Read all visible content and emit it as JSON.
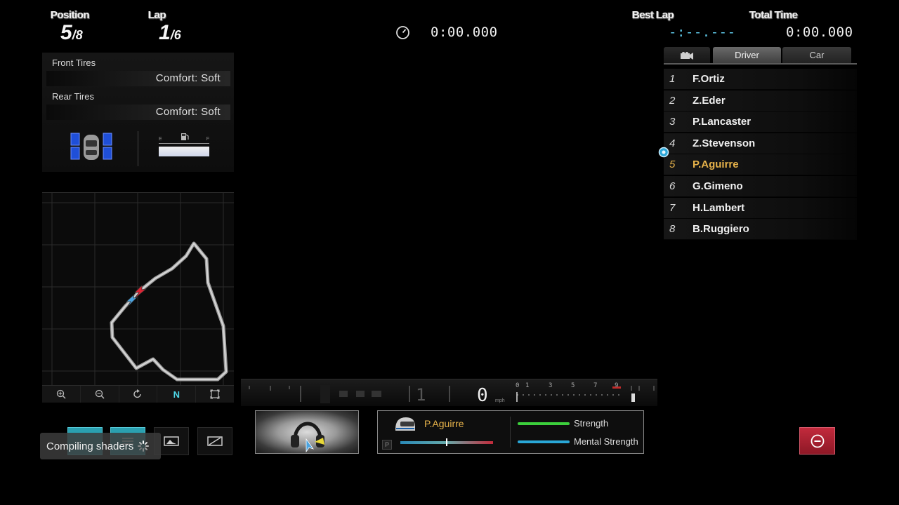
{
  "hud": {
    "position_label": "Position",
    "position_num": "5",
    "position_den": "/8",
    "lap_label": "Lap",
    "lap_num": "1",
    "lap_den": "/6",
    "stopwatch_time": "0:00.000",
    "best_lap_label": "Best Lap",
    "best_lap_value": "-:--.---",
    "total_time_label": "Total Time",
    "total_time_value": "0:00.000"
  },
  "tires": {
    "front_label": "Front Tires",
    "front_value": "Comfort: Soft",
    "rear_label": "Rear Tires",
    "rear_value": "Comfort: Soft",
    "fuel_empty_label": "E",
    "fuel_full_label": "F",
    "fuel_level": 1.0
  },
  "tabs": {
    "camera_icon": "camera-icon",
    "driver_label": "Driver",
    "car_label": "Car",
    "active": "Driver"
  },
  "standings": [
    {
      "pos": "1",
      "name": "F.Ortiz"
    },
    {
      "pos": "2",
      "name": "Z.Eder"
    },
    {
      "pos": "3",
      "name": "P.Lancaster"
    },
    {
      "pos": "4",
      "name": "Z.Stevenson"
    },
    {
      "pos": "5",
      "name": "P.Aguirre",
      "highlight": true
    },
    {
      "pos": "6",
      "name": "G.Gimeno"
    },
    {
      "pos": "7",
      "name": "H.Lambert"
    },
    {
      "pos": "8",
      "name": "B.Ruggiero"
    }
  ],
  "map_toolbar": [
    "zoom-in-icon",
    "zoom-out-icon",
    "rotate-icon",
    "north-icon",
    "fullscreen-icon"
  ],
  "map_north_label": "N",
  "dashboard": {
    "gear": "1",
    "speed": "0",
    "speed_unit": "mph",
    "rev_labels": [
      "0",
      "1",
      "3",
      "5",
      "7",
      "9"
    ]
  },
  "driver_panel": {
    "name": "P.Aguirre",
    "pit_label": "P",
    "strength_label": "Strength",
    "mental_label": "Mental Strength",
    "strength_color": "#3ccf3c",
    "mental_color": "#2aa8d8"
  },
  "toast": {
    "text": "Compiling shaders"
  },
  "colors": {
    "highlight": "#e6b24a",
    "stop_button": "#c22a3c"
  }
}
